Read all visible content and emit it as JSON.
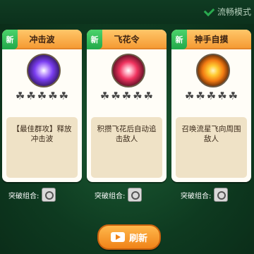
{
  "status": {
    "mode_label": "流畅模式"
  },
  "cards": [
    {
      "badge": "新",
      "title": "冲击波",
      "icon": "shockwave-icon",
      "stars": [
        "☘",
        "☘",
        "☘",
        "☘",
        "☘"
      ],
      "description": "【最佳群攻】释放冲击波"
    },
    {
      "badge": "新",
      "title": "飞花令",
      "icon": "flying-flower-icon",
      "stars": [
        "☘",
        "☘",
        "☘",
        "☘",
        "☘"
      ],
      "description": "积攒飞花后自动追击敌人"
    },
    {
      "badge": "新",
      "title": "神手自摸",
      "icon": "divine-hand-icon",
      "stars": [
        "☘",
        "☘",
        "☘",
        "☘",
        "☘"
      ],
      "description": "召唤流星飞向周围敌人"
    }
  ],
  "combos": [
    {
      "label": "突破组合:"
    },
    {
      "label": "突破组合:"
    },
    {
      "label": "突破组合:"
    }
  ],
  "refresh_button": {
    "label": "刷新",
    "icon": "video-ad-icon"
  }
}
